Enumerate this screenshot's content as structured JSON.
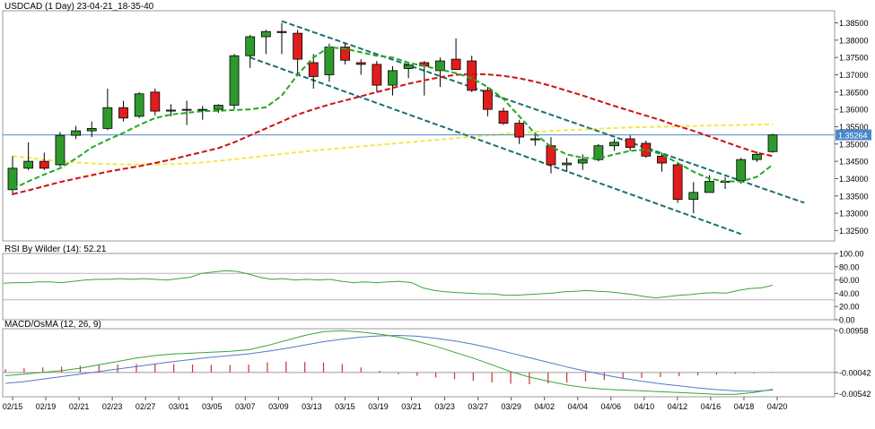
{
  "colors": {
    "up": "#2e9a2e",
    "down": "#e11c1c",
    "ma_fast": "#22aa22",
    "ma_slow": "#cc1111",
    "ma_long": "#f2e84a",
    "channel": "#1f6f6f",
    "price_line": "#4a89c8",
    "rsi": "#3aa43a",
    "macd_line": "#5577cc",
    "signal_line": "#3aa43a",
    "osma": "#cc3333",
    "panel_border": "#9a9a9a",
    "grid": "#dddddd"
  },
  "chart_data": [
    {
      "type": "candlestick",
      "title": "USDCAD (1 Day) 23-04-21_18-35-40",
      "x_labels": [
        "02/15",
        "02/19",
        "02/21",
        "02/23",
        "02/27",
        "03/01",
        "03/05",
        "03/07",
        "03/09",
        "03/13",
        "03/15",
        "03/19",
        "03/21",
        "03/23",
        "03/27",
        "03/29",
        "04/02",
        "04/04",
        "04/06",
        "04/10",
        "04/12",
        "04/16",
        "04/18",
        "04/20"
      ],
      "ylim": [
        1.322,
        1.3885
      ],
      "y_ticks": [
        1.325,
        1.33,
        1.335,
        1.34,
        1.345,
        1.35,
        1.355,
        1.36,
        1.365,
        1.37,
        1.375,
        1.38,
        1.385
      ],
      "y_tick_labels": [
        "1.32500",
        "1.33000",
        "1.33500",
        "1.34000",
        "1.34500",
        "1.35000",
        "1.35500",
        "1.36000",
        "1.36500",
        "1.37000",
        "1.37500",
        "1.38000",
        "1.38500"
      ],
      "current_price": 1.35264,
      "current_price_label": "1.35264",
      "candles": [
        {
          "o": 1.3368,
          "h": 1.3465,
          "l": 1.3352,
          "c": 1.343
        },
        {
          "o": 1.343,
          "h": 1.3505,
          "l": 1.3425,
          "c": 1.345
        },
        {
          "o": 1.345,
          "h": 1.3475,
          "l": 1.3425,
          "c": 1.343
        },
        {
          "o": 1.344,
          "h": 1.3535,
          "l": 1.3435,
          "c": 1.3525
        },
        {
          "o": 1.3525,
          "h": 1.3552,
          "l": 1.3515,
          "c": 1.3538
        },
        {
          "o": 1.3538,
          "h": 1.3565,
          "l": 1.352,
          "c": 1.3545
        },
        {
          "o": 1.3545,
          "h": 1.366,
          "l": 1.354,
          "c": 1.3605
        },
        {
          "o": 1.3605,
          "h": 1.3625,
          "l": 1.3565,
          "c": 1.3575
        },
        {
          "o": 1.358,
          "h": 1.365,
          "l": 1.3575,
          "c": 1.3645
        },
        {
          "o": 1.365,
          "h": 1.366,
          "l": 1.3582,
          "c": 1.3595
        },
        {
          "o": 1.3595,
          "h": 1.3615,
          "l": 1.358,
          "c": 1.3598
        },
        {
          "o": 1.3598,
          "h": 1.3625,
          "l": 1.3555,
          "c": 1.36
        },
        {
          "o": 1.3598,
          "h": 1.361,
          "l": 1.357,
          "c": 1.36
        },
        {
          "o": 1.36,
          "h": 1.3615,
          "l": 1.359,
          "c": 1.3612
        },
        {
          "o": 1.3612,
          "h": 1.376,
          "l": 1.36,
          "c": 1.3755
        },
        {
          "o": 1.3755,
          "h": 1.3815,
          "l": 1.372,
          "c": 1.381
        },
        {
          "o": 1.381,
          "h": 1.383,
          "l": 1.376,
          "c": 1.3825
        },
        {
          "o": 1.3825,
          "h": 1.385,
          "l": 1.376,
          "c": 1.3822
        },
        {
          "o": 1.382,
          "h": 1.383,
          "l": 1.37,
          "c": 1.3745
        },
        {
          "o": 1.3735,
          "h": 1.376,
          "l": 1.366,
          "c": 1.3695
        },
        {
          "o": 1.37,
          "h": 1.379,
          "l": 1.368,
          "c": 1.378
        },
        {
          "o": 1.378,
          "h": 1.379,
          "l": 1.373,
          "c": 1.3742
        },
        {
          "o": 1.3735,
          "h": 1.3745,
          "l": 1.37,
          "c": 1.373
        },
        {
          "o": 1.373,
          "h": 1.374,
          "l": 1.365,
          "c": 1.367
        },
        {
          "o": 1.367,
          "h": 1.3725,
          "l": 1.364,
          "c": 1.3712
        },
        {
          "o": 1.3718,
          "h": 1.3732,
          "l": 1.369,
          "c": 1.3728
        },
        {
          "o": 1.3735,
          "h": 1.374,
          "l": 1.364,
          "c": 1.3725
        },
        {
          "o": 1.3712,
          "h": 1.375,
          "l": 1.3665,
          "c": 1.374
        },
        {
          "o": 1.3745,
          "h": 1.3805,
          "l": 1.3715,
          "c": 1.3715
        },
        {
          "o": 1.374,
          "h": 1.3755,
          "l": 1.365,
          "c": 1.3655
        },
        {
          "o": 1.3655,
          "h": 1.3665,
          "l": 1.358,
          "c": 1.36
        },
        {
          "o": 1.3595,
          "h": 1.3605,
          "l": 1.3555,
          "c": 1.356
        },
        {
          "o": 1.356,
          "h": 1.357,
          "l": 1.35,
          "c": 1.352
        },
        {
          "o": 1.3512,
          "h": 1.353,
          "l": 1.3495,
          "c": 1.3515
        },
        {
          "o": 1.3495,
          "h": 1.352,
          "l": 1.3415,
          "c": 1.344
        },
        {
          "o": 1.344,
          "h": 1.346,
          "l": 1.342,
          "c": 1.3445
        },
        {
          "o": 1.3445,
          "h": 1.347,
          "l": 1.3425,
          "c": 1.3455
        },
        {
          "o": 1.3455,
          "h": 1.35,
          "l": 1.345,
          "c": 1.3495
        },
        {
          "o": 1.3495,
          "h": 1.3515,
          "l": 1.348,
          "c": 1.3505
        },
        {
          "o": 1.3515,
          "h": 1.3525,
          "l": 1.348,
          "c": 1.349
        },
        {
          "o": 1.3502,
          "h": 1.351,
          "l": 1.346,
          "c": 1.3465
        },
        {
          "o": 1.3465,
          "h": 1.3475,
          "l": 1.342,
          "c": 1.3445
        },
        {
          "o": 1.344,
          "h": 1.3445,
          "l": 1.333,
          "c": 1.334
        },
        {
          "o": 1.334,
          "h": 1.339,
          "l": 1.33,
          "c": 1.336
        },
        {
          "o": 1.336,
          "h": 1.341,
          "l": 1.336,
          "c": 1.3392
        },
        {
          "o": 1.3392,
          "h": 1.3405,
          "l": 1.337,
          "c": 1.339
        },
        {
          "o": 1.3395,
          "h": 1.346,
          "l": 1.3385,
          "c": 1.3455
        },
        {
          "o": 1.3455,
          "h": 1.3478,
          "l": 1.3448,
          "c": 1.347
        },
        {
          "o": 1.3478,
          "h": 1.353,
          "l": 1.3475,
          "c": 1.3526
        }
      ],
      "ma_fast": [
        1.337,
        1.3392,
        1.3412,
        1.343,
        1.3458,
        1.349,
        1.3512,
        1.3532,
        1.3555,
        1.3575,
        1.3585,
        1.359,
        1.3595,
        1.3596,
        1.3598,
        1.36,
        1.3606,
        1.364,
        1.37,
        1.375,
        1.378,
        1.3775,
        1.3765,
        1.3755,
        1.375,
        1.3735,
        1.3725,
        1.3715,
        1.3705,
        1.369,
        1.3665,
        1.363,
        1.358,
        1.353,
        1.3492,
        1.347,
        1.346,
        1.3458,
        1.347,
        1.348,
        1.3484,
        1.347,
        1.3445,
        1.342,
        1.34,
        1.3392,
        1.3392,
        1.3405,
        1.344
      ],
      "ma_slow": [
        1.3355,
        1.3366,
        1.3378,
        1.339,
        1.34,
        1.341,
        1.342,
        1.3428,
        1.3436,
        1.3445,
        1.3455,
        1.3466,
        1.3477,
        1.3488,
        1.3505,
        1.3525,
        1.3545,
        1.3565,
        1.3585,
        1.36,
        1.3614,
        1.3626,
        1.3638,
        1.365,
        1.3662,
        1.3674,
        1.3684,
        1.3693,
        1.37,
        1.3702,
        1.3701,
        1.3697,
        1.369,
        1.368,
        1.3668,
        1.3654,
        1.364,
        1.3625,
        1.361,
        1.3596,
        1.3582,
        1.3568,
        1.3552,
        1.3538,
        1.3522,
        1.3506,
        1.349,
        1.3475,
        1.3465
      ],
      "ma_long": [
        1.3465,
        1.346,
        1.3455,
        1.345,
        1.3447,
        1.3444,
        1.3442,
        1.3441,
        1.3441,
        1.3441,
        1.3442,
        1.3444,
        1.3447,
        1.3451,
        1.3456,
        1.3461,
        1.3466,
        1.3471,
        1.3476,
        1.3481,
        1.3485,
        1.3489,
        1.3493,
        1.3497,
        1.3501,
        1.3505,
        1.3509,
        1.3513,
        1.3517,
        1.3521,
        1.3525,
        1.3529,
        1.3532,
        1.3535,
        1.3538,
        1.354,
        1.3542,
        1.3544,
        1.3546,
        1.3548,
        1.3549,
        1.355,
        1.3551,
        1.3552,
        1.3553,
        1.3554,
        1.3555,
        1.3556,
        1.3557
      ],
      "channel_lines": [
        {
          "from": [
            17,
            1.3855
          ],
          "to": [
            50,
            1.333
          ]
        },
        {
          "from": [
            15,
            1.375
          ],
          "to": [
            46,
            1.324
          ]
        }
      ]
    },
    {
      "type": "line",
      "title": "RSI By Wilder (14): 52.21",
      "ylim": [
        0,
        100
      ],
      "y_ticks": [
        0,
        20,
        40,
        60,
        80,
        100
      ],
      "y_tick_labels": [
        "0.00",
        "20.00",
        "40.00",
        "60.00",
        "80.00",
        "100.00"
      ],
      "reference_lines": [
        30,
        70
      ],
      "values": [
        55,
        56,
        56,
        57,
        57,
        56,
        58,
        60,
        61,
        61,
        62,
        61,
        62,
        61,
        60,
        62,
        64,
        70,
        72,
        74,
        73,
        69,
        64,
        61,
        62,
        60,
        61,
        60,
        61,
        58,
        56,
        57,
        56,
        57,
        58,
        56,
        48,
        44,
        42,
        41,
        40,
        39,
        39,
        37,
        37,
        38,
        39,
        40,
        42,
        43,
        44,
        43,
        42,
        40,
        38,
        35,
        33,
        35,
        37,
        38,
        40,
        41,
        40,
        44,
        47,
        48,
        52
      ]
    },
    {
      "type": "line",
      "title": "MACD/OsMA (12, 26, 9)",
      "ylim": [
        -0.0062,
        0.01
      ],
      "y_ticks": [
        0.00958,
        -0.00042,
        -0.00542
      ],
      "y_tick_labels": [
        "0.00958",
        "-0.00042",
        "-0.00542"
      ],
      "macd": [
        -0.0012,
        -0.0008,
        -0.0004,
        0.0,
        0.0006,
        0.0014,
        0.0022,
        0.003,
        0.0036,
        0.004,
        0.0042,
        0.0044,
        0.0046,
        0.005,
        0.006,
        0.0072,
        0.0084,
        0.0093,
        0.0095,
        0.0092,
        0.0087,
        0.008,
        0.007,
        0.0058,
        0.0044,
        0.003,
        0.0014,
        -0.0002,
        -0.0015,
        -0.0025,
        -0.0034,
        -0.004,
        -0.0044,
        -0.0046,
        -0.0048,
        -0.005,
        -0.0052,
        -0.0054,
        -0.0056,
        -0.0056,
        -0.0052,
        -0.0044
      ],
      "signal": [
        -0.003,
        -0.0026,
        -0.002,
        -0.0014,
        -0.0008,
        -0.0002,
        0.0004,
        0.001,
        0.0016,
        0.0022,
        0.0027,
        0.0032,
        0.0036,
        0.004,
        0.0046,
        0.0053,
        0.0061,
        0.0069,
        0.0075,
        0.008,
        0.0083,
        0.0084,
        0.0082,
        0.0077,
        0.0071,
        0.0063,
        0.0053,
        0.0042,
        0.0031,
        0.002,
        0.0009,
        -0.0001,
        -0.001,
        -0.0018,
        -0.0025,
        -0.0031,
        -0.0036,
        -0.0041,
        -0.0045,
        -0.0048,
        -0.0049,
        -0.0046
      ],
      "osma": [
        0.0008,
        0.001,
        0.0012,
        0.0014,
        0.0016,
        0.0018,
        0.0019,
        0.002,
        0.002,
        0.002,
        0.0019,
        0.0018,
        0.0018,
        0.0019,
        0.0024,
        0.0026,
        0.0025,
        0.0024,
        0.002,
        0.0012,
        0.0004,
        -0.0004,
        -0.0008,
        -0.0012,
        -0.0016,
        -0.002,
        -0.0024,
        -0.0027,
        -0.0028,
        -0.0026,
        -0.0024,
        -0.0021,
        -0.0018,
        -0.0015,
        -0.0013,
        -0.0011,
        -0.0009,
        -0.0007,
        -0.0005,
        -0.0003,
        -0.0002,
        -0.0001
      ]
    }
  ]
}
